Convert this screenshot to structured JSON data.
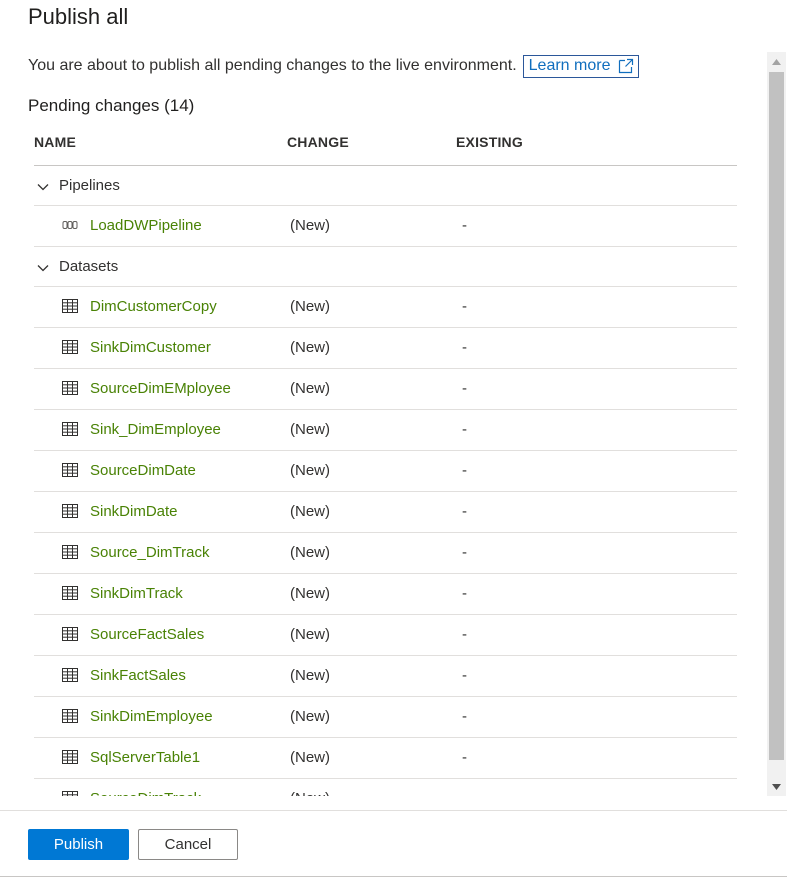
{
  "dialog": {
    "title": "Publish all",
    "description": "You are about to publish all pending changes to the live environment.",
    "learn_more": "Learn more"
  },
  "pending": {
    "title": "Pending changes (14)"
  },
  "table": {
    "headers": {
      "name": "NAME",
      "change": "CHANGE",
      "existing": "EXISTING"
    },
    "groups": [
      {
        "label": "Pipelines",
        "icon": "pipeline-icon",
        "items": [
          {
            "name": "LoadDWPipeline",
            "change": "(New)",
            "existing": "-"
          }
        ]
      },
      {
        "label": "Datasets",
        "icon": "table-icon",
        "items": [
          {
            "name": "DimCustomerCopy",
            "change": "(New)",
            "existing": "-"
          },
          {
            "name": "SinkDimCustomer",
            "change": "(New)",
            "existing": "-"
          },
          {
            "name": "SourceDimEMployee",
            "change": "(New)",
            "existing": "-"
          },
          {
            "name": "Sink_DimEmployee",
            "change": "(New)",
            "existing": "-"
          },
          {
            "name": "SourceDimDate",
            "change": "(New)",
            "existing": "-"
          },
          {
            "name": "SinkDimDate",
            "change": "(New)",
            "existing": "-"
          },
          {
            "name": "Source_DimTrack",
            "change": "(New)",
            "existing": "-"
          },
          {
            "name": "SinkDimTrack",
            "change": "(New)",
            "existing": "-"
          },
          {
            "name": "SourceFactSales",
            "change": "(New)",
            "existing": "-"
          },
          {
            "name": "SinkFactSales",
            "change": "(New)",
            "existing": "-"
          },
          {
            "name": "SinkDimEmployee",
            "change": "(New)",
            "existing": "-"
          },
          {
            "name": "SqlServerTable1",
            "change": "(New)",
            "existing": "-"
          },
          {
            "name": "SourceDimTrack",
            "change": "(New)",
            "existing": "-"
          }
        ]
      }
    ]
  },
  "footer": {
    "publish_label": "Publish",
    "cancel_label": "Cancel"
  },
  "colors": {
    "primary": "#0078d4",
    "item_link": "#498205",
    "link": "#106ebe"
  }
}
